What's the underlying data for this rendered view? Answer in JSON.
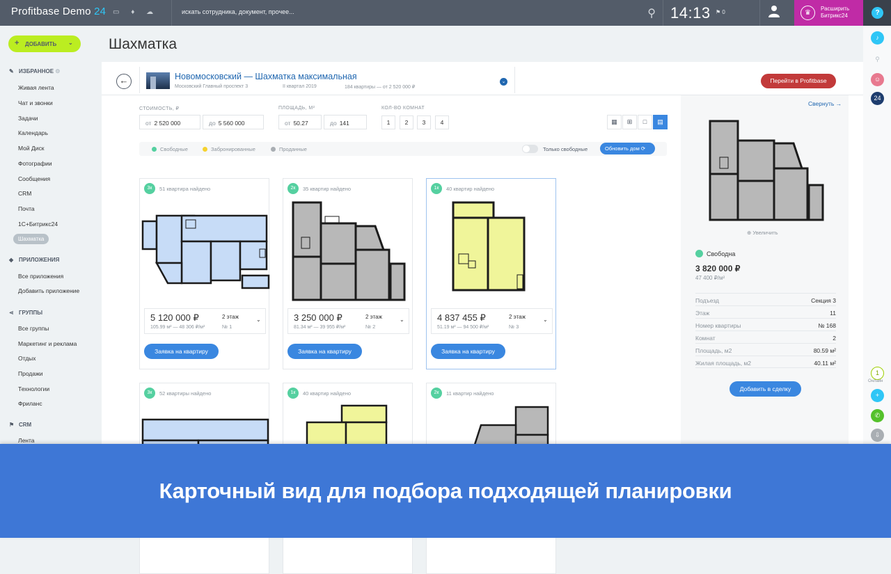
{
  "topbar": {
    "logo_main": "Profitbase Demo",
    "logo_suffix": "24",
    "icons_text": "▭ ♦ ☁",
    "search_placeholder": "искать сотрудника, документ, прочее...",
    "time": "14:13",
    "notif": "⚑ 0",
    "extend_line1": "Расширить",
    "extend_line2": "Битрикс24",
    "help": "?"
  },
  "sidebar": {
    "add_label": "ДОБАВИТЬ",
    "sections": [
      {
        "label": "ИЗБРАННОЕ",
        "items": [
          "Живая лента",
          "Чат и звонки",
          "Задачи",
          "Календарь",
          "Мой Диск",
          "Фотографии",
          "Сообщения",
          "CRM",
          "Почта",
          "1С+Битрикс24",
          "Шахматка"
        ]
      },
      {
        "label": "ПРИЛОЖЕНИЯ",
        "items": [
          "Все приложения",
          "Добавить приложение"
        ]
      },
      {
        "label": "ГРУППЫ",
        "items": [
          "Все группы",
          "Маркетинг и реклама",
          "Отдых",
          "Продажи",
          "Технологии",
          "Фриланс"
        ]
      },
      {
        "label": "CRM",
        "items": [
          "Лента"
        ]
      }
    ]
  },
  "page": {
    "title": "Шахматка"
  },
  "project": {
    "name": "Новомосковский — Шахматка максимальная",
    "address": "Московский Главный проспект 3",
    "quarter": "II квартал 2019",
    "count": "184 квартиры — от 2 520 000 ₽",
    "goto_label": "Перейти в Profitbase"
  },
  "filters": {
    "price_label": "СТОИМОСТЬ, ₽",
    "area_label": "ПЛОЩАДЬ, М²",
    "rooms_label": "КОЛ-ВО КОМНАТ",
    "from": "от",
    "to": "до",
    "price_from": "2 520 000",
    "price_to": "5 560 000",
    "area_from": "50.27",
    "area_to": "141",
    "rooms": [
      "1",
      "2",
      "3",
      "4"
    ]
  },
  "legend": {
    "free": "Свободные",
    "booked": "Забронированные",
    "sold": "Проданные",
    "only_free": "Только свободные",
    "refresh": "Обновить дом"
  },
  "colors": {
    "free": "#55d0a0",
    "booked": "#f5d22f",
    "sold": "#a9aeb3",
    "accent": "#3a87e0"
  },
  "cards": [
    {
      "badge": "3к",
      "found": "51 квартира найдено",
      "price": "5 120 000 ₽",
      "ppm": "105.99 м² — 48 306 ₽/м²",
      "floor": "2 этаж",
      "num": "№ 1",
      "req": "Заявка на квартиру"
    },
    {
      "badge": "2к",
      "found": "35 квартир найдено",
      "price": "3 250 000 ₽",
      "ppm": "81.34 м² — 39 955 ₽/м²",
      "floor": "2 этаж",
      "num": "№ 2",
      "req": "Заявка на квартиру"
    },
    {
      "badge": "1к",
      "found": "40 квартир найдено",
      "price": "4 837 455 ₽",
      "ppm": "51.19 м² — 94 500 ₽/м²",
      "floor": "2 этаж",
      "num": "№ 3",
      "req": "Заявка на квартиру"
    },
    {
      "badge": "3к",
      "found": "52 квартиры найдено"
    },
    {
      "badge": "1к",
      "found": "40 квартир найдено"
    },
    {
      "badge": "2к",
      "found": "11 квартир найдено"
    }
  ],
  "detail": {
    "collapse": "Свернуть →",
    "zoom": "⊕ Увеличить",
    "status": "Свободна",
    "price": "3 820 000 ₽",
    "ppm": "47 400 ₽/м²",
    "props": [
      {
        "k": "Подъезд",
        "v": "Секция 3"
      },
      {
        "k": "Этаж",
        "v": "11"
      },
      {
        "k": "Номер квартиры",
        "v": "№ 168"
      },
      {
        "k": "Комнат",
        "v": "2"
      },
      {
        "k": "Площадь, м2",
        "v": "80.59 м²"
      },
      {
        "k": "Жилая площадь, м2",
        "v": "40.11 м²"
      }
    ],
    "add_deal": "Добавить в сделку"
  },
  "right_strip": {
    "badge24": "24",
    "online_count": "1",
    "online_label": "Онлайн"
  },
  "banner": {
    "text": "Карточный вид для подбора подходящей планировки"
  }
}
